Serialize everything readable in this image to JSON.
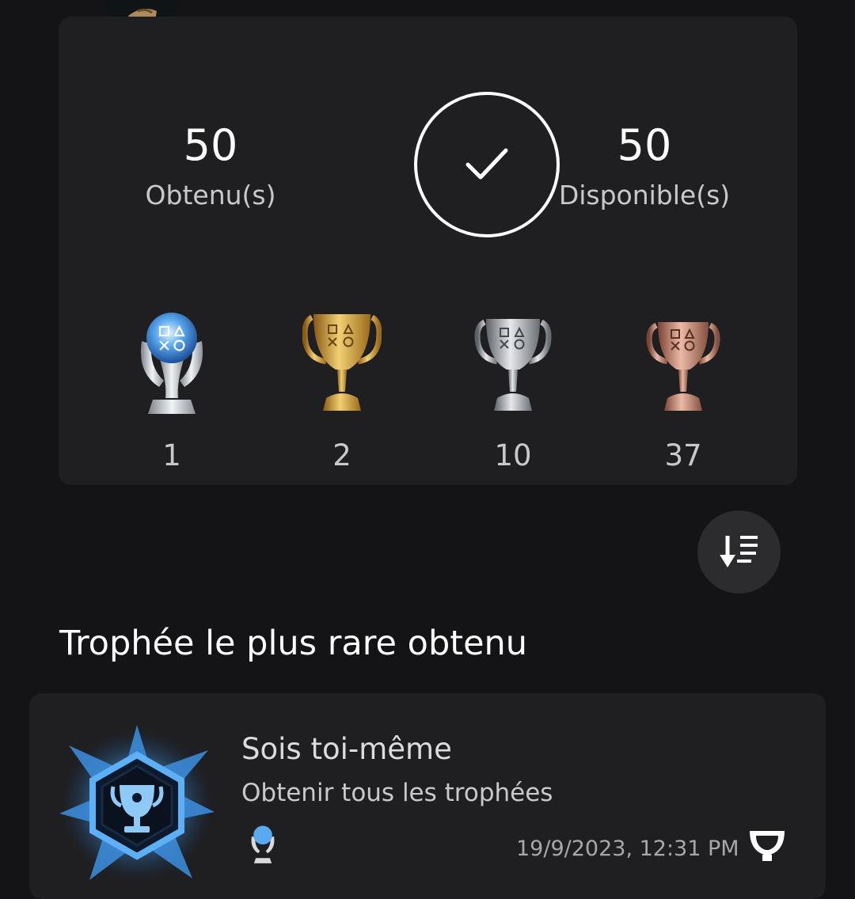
{
  "header": {
    "game_icon": "spider-man-game-icon"
  },
  "summary": {
    "earned_value": "50",
    "earned_label": "Obtenu(s)",
    "available_value": "50",
    "available_label": "Disponible(s)",
    "completion_icon": "checkmark-icon",
    "completion_progress": 1.0
  },
  "trophies": [
    {
      "grade": "platinum",
      "icon": "platinum-trophy-icon",
      "count": "1",
      "color": "#6fb4f0"
    },
    {
      "grade": "gold",
      "icon": "gold-trophy-icon",
      "count": "2",
      "color": "#d7a33c"
    },
    {
      "grade": "silver",
      "icon": "silver-trophy-icon",
      "count": "10",
      "color": "#b4b6b8"
    },
    {
      "grade": "bronze",
      "icon": "bronze-trophy-icon",
      "count": "37",
      "color": "#c98a76"
    }
  ],
  "sort_button": {
    "icon": "sort-descending-icon"
  },
  "rarest": {
    "section_title": "Trophée le plus rare obtenu",
    "name": "Sois toi-même",
    "description": "Obtenir tous les trophées",
    "grade_icon": "platinum-trophy-icon",
    "date": "19/9/2023, 12:31 PM",
    "trophy_icon": "trophy-icon"
  },
  "colors": {
    "background": "#141416",
    "card": "#1f1f21",
    "button": "#2c2c2e"
  }
}
